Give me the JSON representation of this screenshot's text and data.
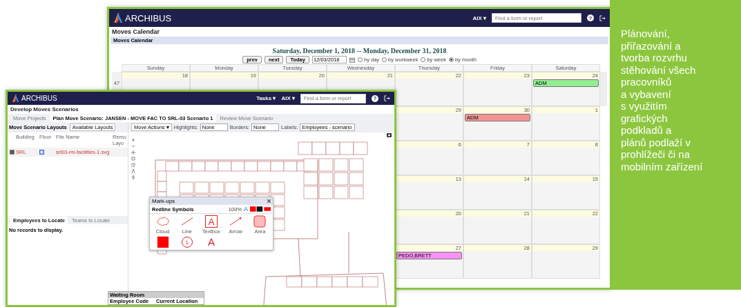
{
  "calendar_window": {
    "brand": "ARCHIBUS",
    "user_menu": "AIX ▾",
    "help": "?",
    "search": {
      "placeholder": "Find a form or report"
    },
    "title": "Moves Calendar",
    "panel_title": "Moves Calendar",
    "range_title": "Saturday, December 1, 2018 -- Monday, December 31, 2018",
    "buttons": [
      "prev",
      "next",
      "Today"
    ],
    "date_value": "12/03/2018",
    "views": [
      {
        "label": "by day",
        "selected": false
      },
      {
        "label": "by workweek",
        "selected": false
      },
      {
        "label": "by week",
        "selected": false
      },
      {
        "label": "by month",
        "selected": true
      }
    ],
    "weekdays": [
      "Sunday",
      "Monday",
      "Tuesday",
      "Wednesday",
      "Thursday",
      "Friday",
      "Saturday"
    ],
    "weeks": [
      {
        "week": "47",
        "days": [
          {
            "date": "18"
          },
          {
            "date": "19"
          },
          {
            "date": "20"
          },
          {
            "date": "21"
          },
          {
            "date": "22"
          },
          {
            "date": "23"
          },
          {
            "date": "24",
            "events": [
              {
                "label": "ADM",
                "color": "#92ee92"
              }
            ]
          }
        ]
      },
      {
        "days": [
          {
            "date": "29"
          },
          {
            "date": "30",
            "events": [
              {
                "label": "ADM",
                "color": "#f29494"
              }
            ]
          },
          {
            "date": "1"
          }
        ]
      },
      {
        "days": [
          {
            "date": "6"
          },
          {
            "date": "7"
          },
          {
            "date": "8"
          }
        ]
      },
      {
        "days": [
          {
            "date": "13"
          },
          {
            "date": "14"
          },
          {
            "date": "15"
          }
        ]
      },
      {
        "days": [
          {
            "date": "20"
          },
          {
            "date": "21"
          },
          {
            "date": "22"
          }
        ]
      },
      {
        "days": [
          {
            "date": "27",
            "events": [
              {
                "label": "PEDO,BRETT",
                "color": "#f792f5"
              }
            ]
          },
          {
            "date": "28"
          },
          {
            "date": "29"
          }
        ]
      }
    ]
  },
  "scenario_window": {
    "brand": "ARCHIBUS",
    "menus": [
      "Tasks ▾",
      "AIX ▾"
    ],
    "help": "?",
    "search": {
      "placeholder": "Find a form or report"
    },
    "title": "Develop Moves Scenarios",
    "tabs": [
      {
        "label": "Move Projects",
        "selected": false
      },
      {
        "label": "Plan Move Scenario: JANSEN - MOVE FAC TO SRL-03 Scenario 1",
        "selected": true
      },
      {
        "label": "Review Move Scenario",
        "selected": false
      }
    ],
    "layouts_panel": {
      "title": "Move Scenario Layouts",
      "button": "Available Layouts",
      "columns": [
        "Building",
        "Floor",
        "File Name",
        "Remo Layo"
      ],
      "rows": [
        {
          "checked": true,
          "building": "SRL",
          "file": "srl03-rm-facilities-1.svg"
        }
      ]
    },
    "bottom_tabs": [
      {
        "label": "Employees to Locate",
        "selected": true
      },
      {
        "label": "Teams to Locate",
        "selected": false
      }
    ],
    "empty_message": "No records to display.",
    "plan_toolbar": {
      "actions": "Move Actions ▾",
      "filters": [
        {
          "label": "Highlights:",
          "value": "None"
        },
        {
          "label": "Borders:",
          "value": "None"
        },
        {
          "label": "Labels:",
          "value": "Employees - scenario"
        }
      ]
    },
    "markups": {
      "title": "Mark-ups",
      "subtitle": "Redline Symbols",
      "zoom": "100%",
      "font_mark": "A",
      "symbols": [
        {
          "kind": "cloud",
          "label": "Cloud"
        },
        {
          "kind": "line",
          "label": "Line"
        },
        {
          "kind": "textbox",
          "label": "Textbox",
          "glyph": "A"
        },
        {
          "kind": "arrow",
          "label": "Arrow"
        },
        {
          "kind": "area",
          "label": "Area"
        },
        {
          "kind": "square"
        },
        {
          "kind": "callout",
          "glyph": "1"
        },
        {
          "kind": "text",
          "glyph": "A"
        }
      ]
    },
    "waiting_room": {
      "title": "Waiting Room",
      "columns": [
        "Employee Code",
        "Current Location"
      ]
    }
  },
  "caption": [
    "Plánování,",
    "přiřazování a",
    "tvorba rozvrhu",
    "stěhování všech",
    "pracovníků",
    "a vybavení",
    "s využitím",
    "grafických",
    "podkladů a",
    "plánů podlaží v",
    "prohlížeči či na",
    "mobilním zařízení"
  ]
}
